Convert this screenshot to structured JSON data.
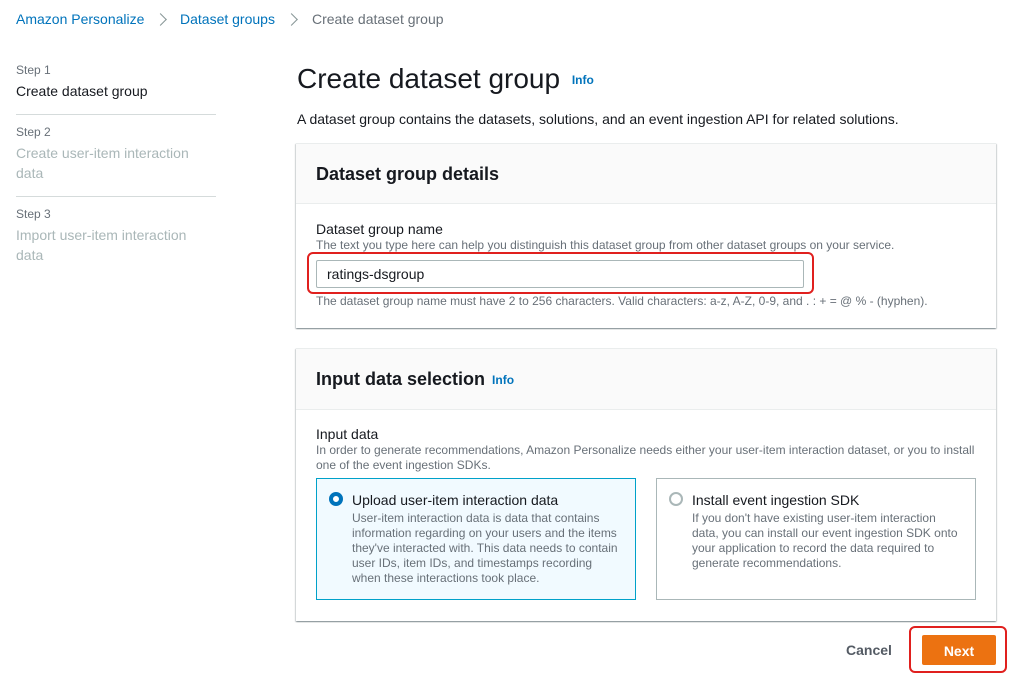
{
  "breadcrumb": {
    "items": [
      "Amazon Personalize",
      "Dataset groups"
    ],
    "current": "Create dataset group"
  },
  "steps": [
    {
      "num": "Step 1",
      "title": "Create dataset group",
      "active": true
    },
    {
      "num": "Step 2",
      "title": "Create user-item interaction data",
      "active": false
    },
    {
      "num": "Step 3",
      "title": "Import user-item interaction data",
      "active": false
    }
  ],
  "page": {
    "title": "Create dataset group",
    "info": "Info",
    "description": "A dataset group contains the datasets, solutions, and an event ingestion API for related solutions."
  },
  "details": {
    "title": "Dataset group details",
    "field_label": "Dataset group name",
    "field_desc": "The text you type here can help you distinguish this dataset group from other dataset groups on your service.",
    "field_value": "ratings-dsgroup",
    "constraint": "The dataset group name must have 2 to 256 characters. Valid characters: a-z, A-Z, 0-9, and . : + = @ % - (hyphen)."
  },
  "input_data": {
    "title": "Input data selection",
    "info": "Info",
    "label": "Input data",
    "desc": "In order to generate recommendations, Amazon Personalize needs either your user-item interaction dataset, or you to install one of the event ingestion SDKs.",
    "options": [
      {
        "title": "Upload user-item interaction data",
        "desc": "User-item interaction data is data that contains information regarding on your users and the items they've interacted with. This data needs to contain user IDs, item IDs, and timestamps recording when these interactions took place.",
        "selected": true
      },
      {
        "title": "Install event ingestion SDK",
        "desc": "If you don't have existing user-item interaction data, you can install our event ingestion SDK onto your application to record the data required to generate recommendations.",
        "selected": false
      }
    ]
  },
  "actions": {
    "cancel": "Cancel",
    "next": "Next"
  },
  "colors": {
    "accent": "#0073bb",
    "primary_button": "#ec7211",
    "highlight": "#e0201e"
  }
}
